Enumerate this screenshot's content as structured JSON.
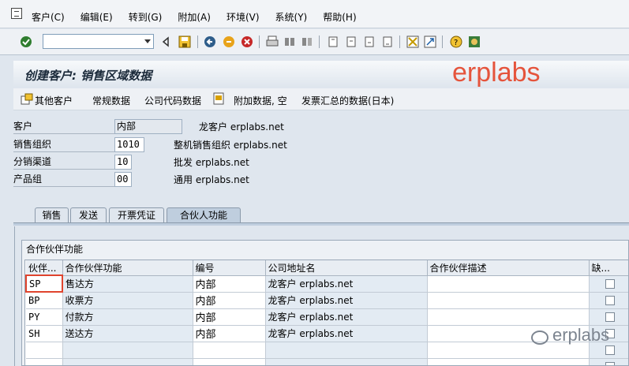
{
  "menu": [
    "客户(C)",
    "编辑(E)",
    "转到(G)",
    "附加(A)",
    "环境(V)",
    "系统(Y)",
    "帮助(H)"
  ],
  "title": "创建客户: 销售区域数据",
  "watermark": "erplabs",
  "app_toolbar": {
    "other_customer": "其他客户",
    "general_data": "常规数据",
    "company_code_data": "公司代码数据",
    "additional_data": "附加数据, 空",
    "invoice_summary": "发票汇总的数据(日本)"
  },
  "fields": [
    {
      "label": "客户",
      "value": "内部",
      "desc": "龙客户 erplabs.net"
    },
    {
      "label": "销售组织",
      "value": "1010",
      "desc": "整机销售组织 erplabs.net"
    },
    {
      "label": "分销渠道",
      "value": "10",
      "desc": "批发 erplabs.net"
    },
    {
      "label": "产品组",
      "value": "00",
      "desc": "通用 erplabs.net"
    }
  ],
  "tabs": [
    "销售",
    "发送",
    "开票凭证",
    "合伙人功能"
  ],
  "group_title": "合作伙伴功能",
  "columns": [
    "伙伴...",
    "合作伙伴功能",
    "编号",
    "公司地址名",
    "合作伙伴描述",
    "缺..."
  ],
  "rows": [
    {
      "key": "SP",
      "fn": "售达方",
      "num": "内部",
      "addr": "龙客户 erplabs.net",
      "desc": ""
    },
    {
      "key": "BP",
      "fn": "收票方",
      "num": "内部",
      "addr": "龙客户 erplabs.net",
      "desc": ""
    },
    {
      "key": "PY",
      "fn": "付款方",
      "num": "内部",
      "addr": "龙客户 erplabs.net",
      "desc": ""
    },
    {
      "key": "SH",
      "fn": "送达方",
      "num": "内部",
      "addr": "龙客户 erplabs.net",
      "desc": ""
    },
    {
      "key": "",
      "fn": "",
      "num": "",
      "addr": "",
      "desc": ""
    },
    {
      "key": "",
      "fn": "",
      "num": "",
      "addr": "",
      "desc": ""
    }
  ],
  "footer_watermark": "erplabs",
  "colors": {
    "accent": "#e5543c",
    "background": "#dfe6ee"
  }
}
